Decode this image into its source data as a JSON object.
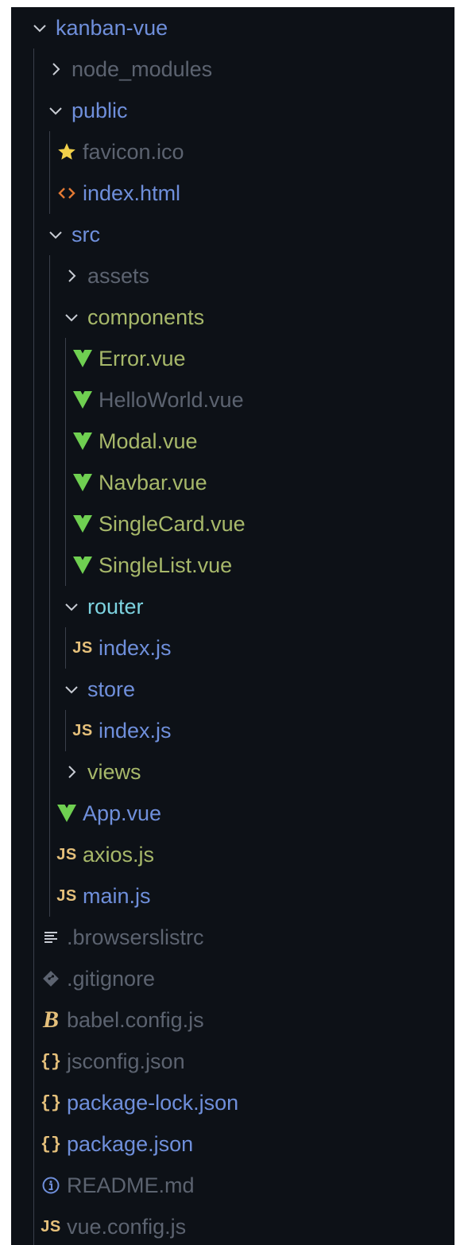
{
  "explorer": {
    "root": {
      "label": "kanban-vue"
    },
    "items": [
      {
        "label": "node_modules"
      },
      {
        "label": "public"
      },
      {
        "label": "favicon.ico"
      },
      {
        "label": "index.html"
      },
      {
        "label": "src"
      },
      {
        "label": "assets"
      },
      {
        "label": "components"
      },
      {
        "label": "Error.vue"
      },
      {
        "label": "HelloWorld.vue"
      },
      {
        "label": "Modal.vue"
      },
      {
        "label": "Navbar.vue"
      },
      {
        "label": "SingleCard.vue"
      },
      {
        "label": "SingleList.vue"
      },
      {
        "label": "router"
      },
      {
        "label": "index.js"
      },
      {
        "label": "store"
      },
      {
        "label": "index.js"
      },
      {
        "label": "views"
      },
      {
        "label": "App.vue"
      },
      {
        "label": "axios.js"
      },
      {
        "label": "main.js"
      },
      {
        "label": ".browserslistrc"
      },
      {
        "label": ".gitignore"
      },
      {
        "label": "babel.config.js"
      },
      {
        "label": "jsconfig.json"
      },
      {
        "label": "package-lock.json"
      },
      {
        "label": "package.json"
      },
      {
        "label": "README.md"
      },
      {
        "label": "vue.config.js"
      }
    ]
  },
  "icons": {
    "js_badge": "JS",
    "json_badge": "{}",
    "babel_badge": "B"
  },
  "colors": {
    "background": "#0d1117",
    "chevron": "#c8ccd4",
    "vue": "#6fcf51",
    "html": "#e37933",
    "js": "#e5c07b",
    "info": "#6f8fdb",
    "muted": "#5c6370",
    "blue_text": "#6f8fdb",
    "olive_text": "#a7b86a",
    "cyan_text": "#7dd3e0"
  }
}
